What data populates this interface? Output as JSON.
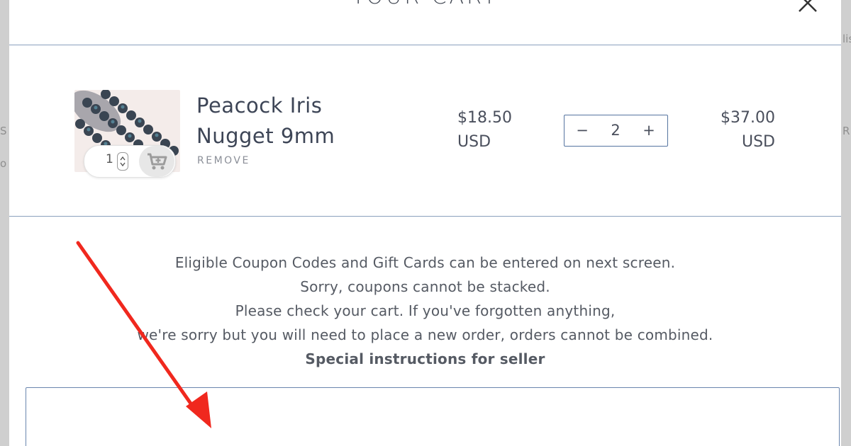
{
  "cart": {
    "title": "YOUR CART",
    "close_icon": "close-icon"
  },
  "backdrop": {
    "left_fragment_1": "S",
    "left_fragment_2": "o",
    "right_fragment_1": "lis",
    "right_fragment_2": "R"
  },
  "item": {
    "name_line1": "Peacock Iris",
    "name_line2": "Nugget 9mm",
    "remove_label": "REMOVE",
    "mini_qty": "1",
    "unit_price": "$18.50",
    "unit_currency": "USD",
    "quantity": "2",
    "qty_minus": "−",
    "qty_plus": "+",
    "line_total": "$37.00",
    "line_currency": "USD"
  },
  "notes": {
    "line1": "Eligible Coupon Codes and Gift Cards can be entered on next screen.",
    "line2": "Sorry, coupons cannot be stacked.",
    "line3": "Please check your cart. If you've forgotten anything,",
    "line4": "we're sorry but you will need to place a new order, orders cannot be combined.",
    "instructions_label": "Special instructions for seller"
  },
  "colors": {
    "annotation_arrow": "#f0281e",
    "rule": "#8aa0bd",
    "accent_border": "#5574a0"
  }
}
